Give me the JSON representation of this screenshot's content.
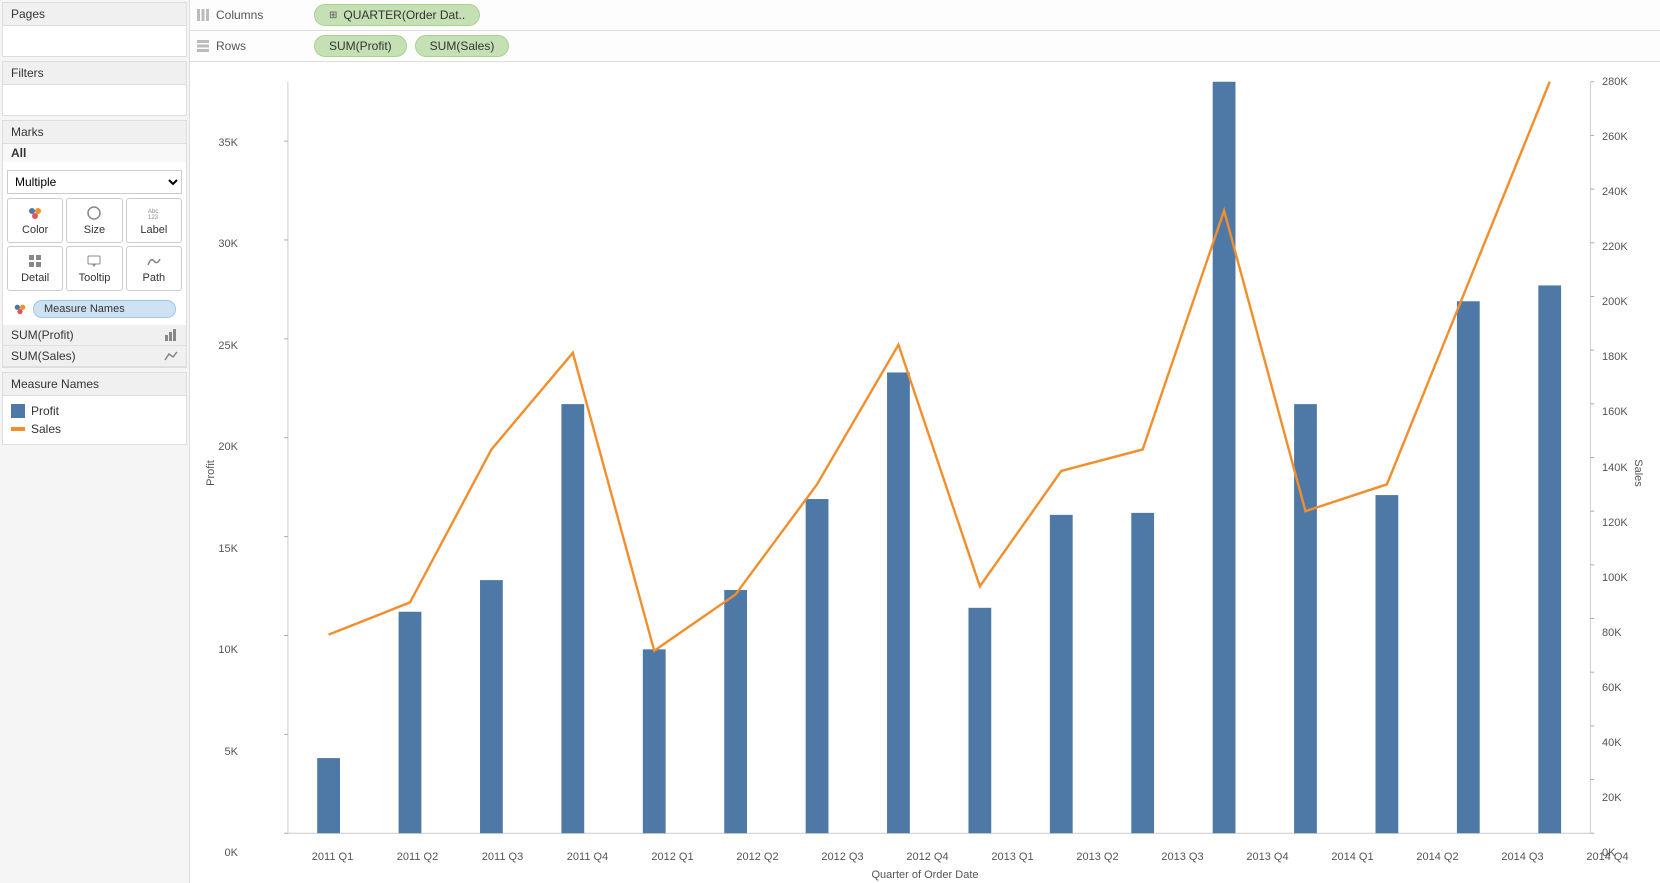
{
  "sidebar": {
    "pages_label": "Pages",
    "filters_label": "Filters",
    "marks_label": "Marks",
    "marks_all": "All",
    "marks_select": "Multiple",
    "mark_buttons": {
      "color": "Color",
      "size": "Size",
      "label": "Label",
      "detail": "Detail",
      "tooltip": "Tooltip",
      "path": "Path"
    },
    "measure_names_pill": "Measure Names",
    "sum_profit": "SUM(Profit)",
    "sum_sales": "SUM(Sales)",
    "legend_header": "Measure Names",
    "legend_profit": "Profit",
    "legend_sales": "Sales"
  },
  "shelves": {
    "columns_label": "Columns",
    "rows_label": "Rows",
    "columns_pill": "QUARTER(Order Dat..",
    "rows_pill1": "SUM(Profit)",
    "rows_pill2": "SUM(Sales)"
  },
  "chart": {
    "y_left_label": "Profit",
    "y_right_label": "Sales",
    "x_label": "Quarter of Order Date"
  },
  "chart_data": {
    "type": "bar+line",
    "categories": [
      "2011 Q1",
      "2011 Q2",
      "2011 Q3",
      "2011 Q4",
      "2012 Q1",
      "2012 Q2",
      "2012 Q3",
      "2012 Q4",
      "2013 Q1",
      "2013 Q2",
      "2013 Q3",
      "2013 Q4",
      "2014 Q1",
      "2014 Q2",
      "2014 Q3",
      "2014 Q4"
    ],
    "series": [
      {
        "name": "Profit",
        "type": "bar",
        "axis": "left",
        "color": "#4e79a7",
        "values": [
          3800,
          11200,
          12800,
          21700,
          9300,
          12300,
          16900,
          23300,
          11400,
          16100,
          16200,
          38000,
          21700,
          17100,
          26900,
          27700
        ]
      },
      {
        "name": "Sales",
        "type": "line",
        "axis": "right",
        "color": "#f28e2b",
        "values": [
          74000,
          86000,
          143000,
          179000,
          68000,
          89000,
          130000,
          182000,
          92000,
          135000,
          143000,
          232000,
          120000,
          130000,
          205000,
          280000
        ]
      }
    ],
    "y_left": {
      "label": "Profit",
      "min": 0,
      "max": 38000,
      "ticks": [
        0,
        5000,
        10000,
        15000,
        20000,
        25000,
        30000,
        35000
      ],
      "tick_labels": [
        "0K",
        "5K",
        "10K",
        "15K",
        "20K",
        "25K",
        "30K",
        "35K"
      ]
    },
    "y_right": {
      "label": "Sales",
      "min": 0,
      "max": 280000,
      "ticks": [
        0,
        20000,
        40000,
        60000,
        80000,
        100000,
        120000,
        140000,
        160000,
        180000,
        200000,
        220000,
        240000,
        260000,
        280000
      ],
      "tick_labels": [
        "0K",
        "20K",
        "40K",
        "60K",
        "80K",
        "100K",
        "120K",
        "140K",
        "160K",
        "180K",
        "200K",
        "220K",
        "240K",
        "260K",
        "280K"
      ]
    },
    "xlabel": "Quarter of Order Date"
  }
}
